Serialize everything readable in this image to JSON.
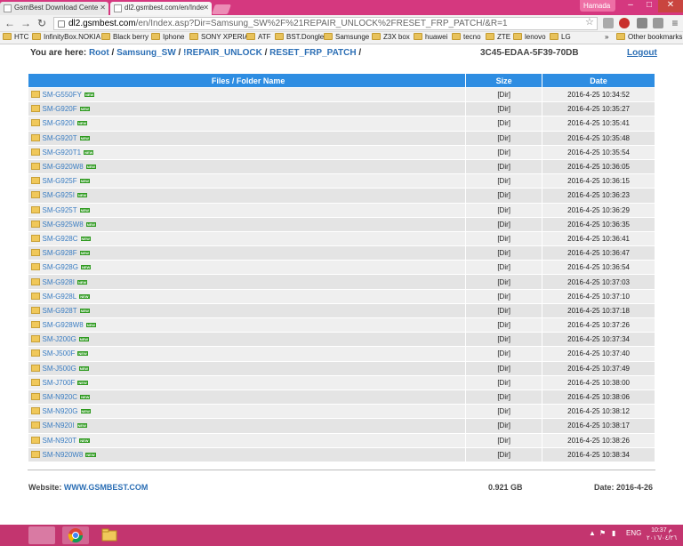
{
  "browser": {
    "tabs": [
      {
        "title": "GsmBest Download Cente",
        "active": false
      },
      {
        "title": "dl2.gsmbest.com/en/Inde",
        "active": true
      }
    ],
    "profile_name": "Hamada",
    "url_host": "dl2.gsmbest.com",
    "url_path": "/en/Index.asp?Dir=Samsung_SW%2F%21REPAIR_UNLOCK%2FRESET_FRP_PATCH/&R=1"
  },
  "bookmarks": [
    "HTC",
    "InfinityBox.NOKIA",
    "Black berry",
    "Iphone",
    "SONY XPERIA",
    "ATF",
    "BST.Dongle",
    "Samsunge",
    "Z3X box",
    "huawei",
    "tecno",
    "ZTE",
    "lenovo",
    "LG"
  ],
  "bookmarks_overflow": "»",
  "other_bookmarks": "Other bookmarks",
  "page": {
    "you_are_here": "You are here:",
    "breadcrumbs": [
      "Root",
      "Samsung_SW",
      "!REPAIR_UNLOCK",
      "RESET_FRP_PATCH"
    ],
    "hash_id": "3C45-EDAA-5F39-70DB",
    "logout": "Logout",
    "columns": [
      "Files / Folder Name",
      "Size",
      "Date"
    ],
    "new_badge": "NEW",
    "rows": [
      {
        "name": "SM-G550FY",
        "size": "[Dir]",
        "date": "2016-4-25 10:34:52"
      },
      {
        "name": "SM-G920F",
        "size": "[Dir]",
        "date": "2016-4-25 10:35:27"
      },
      {
        "name": "SM-G920I",
        "size": "[Dir]",
        "date": "2016-4-25 10:35:41"
      },
      {
        "name": "SM-G920T",
        "size": "[Dir]",
        "date": "2016-4-25 10:35:48"
      },
      {
        "name": "SM-G920T1",
        "size": "[Dir]",
        "date": "2016-4-25 10:35:54"
      },
      {
        "name": "SM-G920W8",
        "size": "[Dir]",
        "date": "2016-4-25 10:36:05"
      },
      {
        "name": "SM-G925F",
        "size": "[Dir]",
        "date": "2016-4-25 10:36:15"
      },
      {
        "name": "SM-G925I",
        "size": "[Dir]",
        "date": "2016-4-25 10:36:23"
      },
      {
        "name": "SM-G925T",
        "size": "[Dir]",
        "date": "2016-4-25 10:36:29"
      },
      {
        "name": "SM-G925W8",
        "size": "[Dir]",
        "date": "2016-4-25 10:36:35"
      },
      {
        "name": "SM-G928C",
        "size": "[Dir]",
        "date": "2016-4-25 10:36:41"
      },
      {
        "name": "SM-G928F",
        "size": "[Dir]",
        "date": "2016-4-25 10:36:47"
      },
      {
        "name": "SM-G928G",
        "size": "[Dir]",
        "date": "2016-4-25 10:36:54"
      },
      {
        "name": "SM-G928I",
        "size": "[Dir]",
        "date": "2016-4-25 10:37:03"
      },
      {
        "name": "SM-G928L",
        "size": "[Dir]",
        "date": "2016-4-25 10:37:10"
      },
      {
        "name": "SM-G928T",
        "size": "[Dir]",
        "date": "2016-4-25 10:37:18"
      },
      {
        "name": "SM-G928W8",
        "size": "[Dir]",
        "date": "2016-4-25 10:37:26"
      },
      {
        "name": "SM-J200G",
        "size": "[Dir]",
        "date": "2016-4-25 10:37:34"
      },
      {
        "name": "SM-J500F",
        "size": "[Dir]",
        "date": "2016-4-25 10:37:40"
      },
      {
        "name": "SM-J500G",
        "size": "[Dir]",
        "date": "2016-4-25 10:37:49"
      },
      {
        "name": "SM-J700F",
        "size": "[Dir]",
        "date": "2016-4-25 10:38:00"
      },
      {
        "name": "SM-N920C",
        "size": "[Dir]",
        "date": "2016-4-25 10:38:06"
      },
      {
        "name": "SM-N920G",
        "size": "[Dir]",
        "date": "2016-4-25 10:38:12"
      },
      {
        "name": "SM-N920I",
        "size": "[Dir]",
        "date": "2016-4-25 10:38:17"
      },
      {
        "name": "SM-N920T",
        "size": "[Dir]",
        "date": "2016-4-25 10:38:26"
      },
      {
        "name": "SM-N920W8",
        "size": "[Dir]",
        "date": "2016-4-25 10:38:34"
      }
    ],
    "footer": {
      "website_label": "Website:",
      "website_link": "WWW.GSMBEST.COM",
      "total_size": "0.921 GB",
      "date_label": "Date:",
      "date_value": "2016-4-26"
    }
  },
  "taskbar": {
    "lang": "ENG",
    "time": "10:37 م",
    "date": "٢٠١٦/٠٤/٢٦"
  },
  "colors": {
    "accent": "#2e8de2",
    "link": "#2c6fb5",
    "window_frame": "#d5387f",
    "taskbar": "#c3356f"
  }
}
